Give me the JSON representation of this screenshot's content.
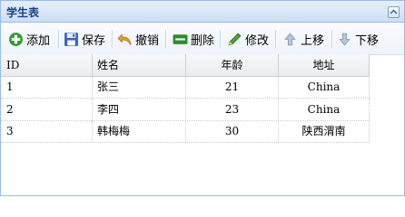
{
  "panel": {
    "title": "学生表"
  },
  "toolbar": {
    "buttons": [
      {
        "label": "添加",
        "icon": "add-icon"
      },
      {
        "label": "保存",
        "icon": "save-icon"
      },
      {
        "label": "撤销",
        "icon": "undo-icon"
      },
      {
        "label": "删除",
        "icon": "delete-icon"
      },
      {
        "label": "修改",
        "icon": "edit-icon"
      },
      {
        "label": "上移",
        "icon": "arrow-up-icon"
      },
      {
        "label": "下移",
        "icon": "arrow-down-icon"
      }
    ]
  },
  "grid": {
    "columns": [
      "ID",
      "姓名",
      "年龄",
      "地址"
    ],
    "rows": [
      [
        "1",
        "张三",
        "21",
        "China"
      ],
      [
        "2",
        "李四",
        "23",
        "China"
      ],
      [
        "3",
        "韩梅梅",
        "30",
        "陕西渭南"
      ]
    ]
  },
  "colors": {
    "header_text": "#15428b",
    "panel_border": "#99bbe8",
    "header_bg": "#d9e6f7"
  }
}
